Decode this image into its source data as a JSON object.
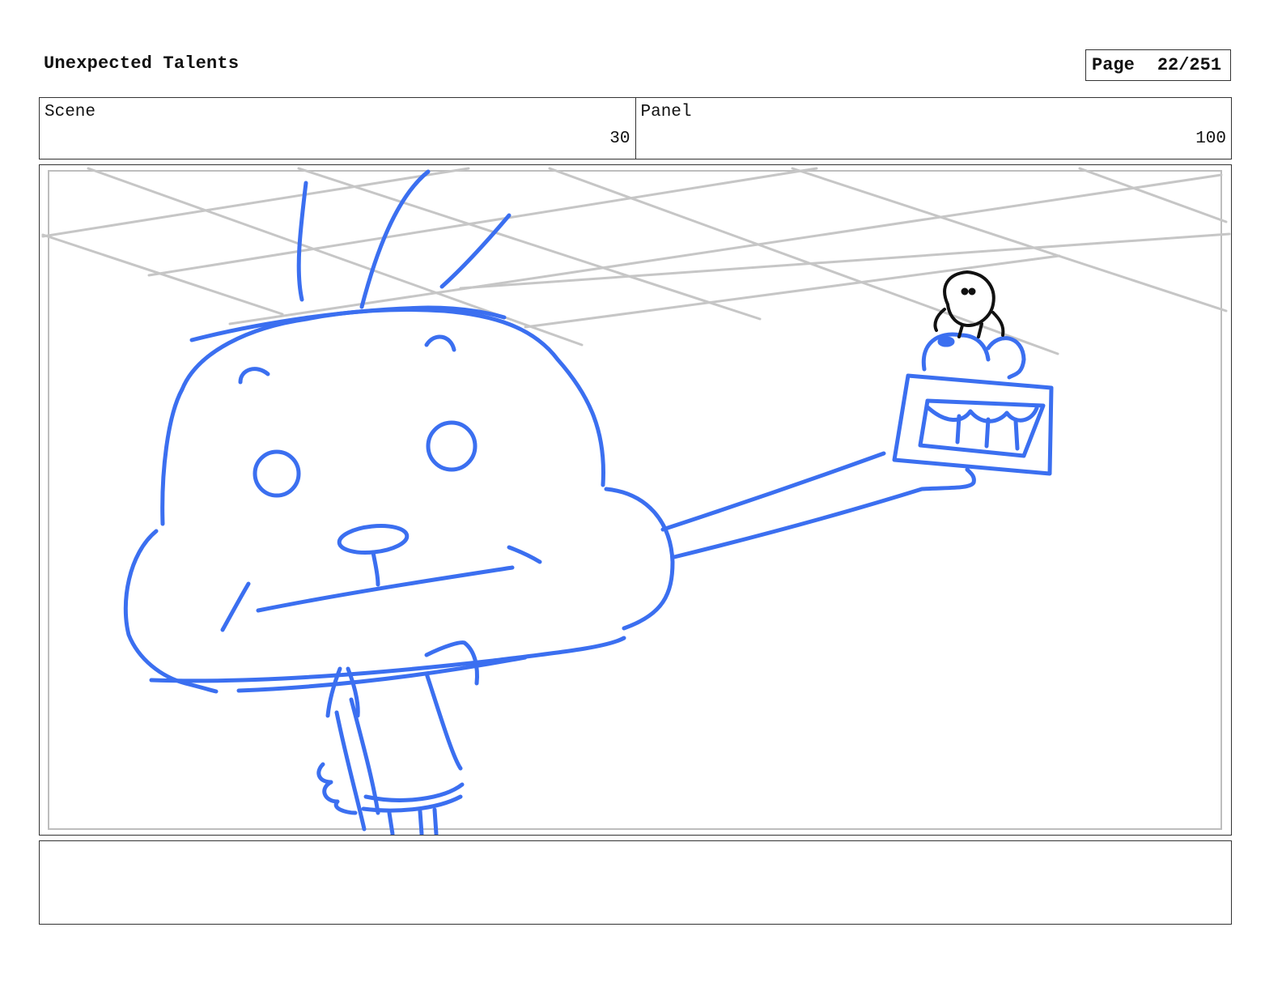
{
  "header": {
    "title": "Unexpected Talents",
    "page_label": "Page",
    "page_value": "22/251"
  },
  "info": {
    "scene_label": "Scene",
    "scene_value": "30",
    "panel_label": "Panel",
    "panel_value": "100"
  },
  "panel": {
    "sketch_color": "#3b6ff0",
    "guide_color": "#c6c6c6",
    "ink_color": "#111111"
  },
  "notes": {
    "text": ""
  }
}
